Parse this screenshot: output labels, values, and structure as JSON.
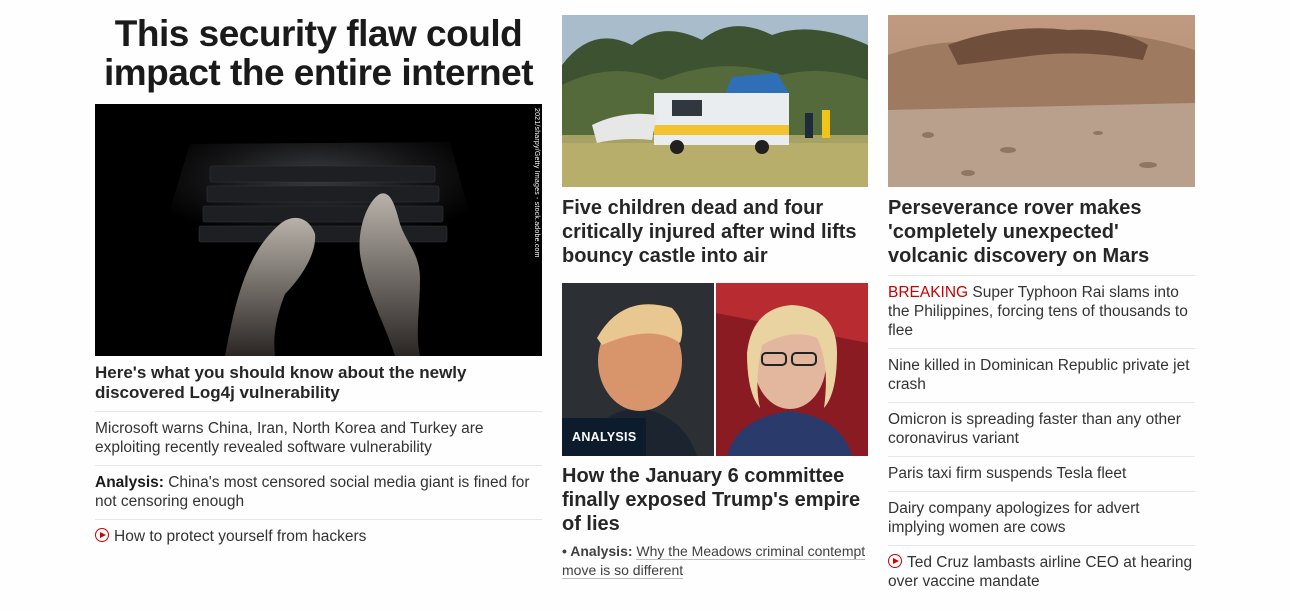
{
  "left": {
    "hero_title": "This security flaw could impact the entire internet",
    "image_credit": "2021/sharpy/Getty Images - stock.adobe.com",
    "headline": "Here's what you should know about the newly discovered Log4j vulnerability",
    "items": [
      {
        "text": "Microsoft warns China, Iran, North Korea and Turkey are exploiting recently revealed software vulnerability"
      },
      {
        "prefix": "Analysis:",
        "text": "China's most censored social media giant is fined for not censoring enough"
      },
      {
        "text": "How to protect yourself from hackers",
        "icon": "play-icon"
      }
    ]
  },
  "middle": {
    "top_headline": "Five children dead and four critically injured after wind lifts bouncy castle into air",
    "badge": "ANALYSIS",
    "second_headline": "How the January 6 committee finally exposed Trump's empire of lies",
    "sub_prefix": "• Analysis:",
    "sub_text": "Why the Meadows criminal contempt move is so different"
  },
  "right": {
    "headline": "Perseverance rover makes 'completely unexpected' volcanic discovery on Mars",
    "items": [
      {
        "label": "BREAKING",
        "text": "Super Typhoon Rai slams into the Philippines, forcing tens of thousands to flee"
      },
      {
        "text": "Nine killed in Dominican Republic private jet crash"
      },
      {
        "text": "Omicron is spreading faster than any other coronavirus variant"
      },
      {
        "text": "Paris taxi firm suspends Tesla fleet"
      },
      {
        "text": "Dairy company apologizes for advert implying women are cows"
      },
      {
        "text": "Ted Cruz lambasts airline CEO at hearing over vaccine mandate",
        "icon": "play-icon"
      }
    ]
  },
  "colors": {
    "accent_red": "#cc0000",
    "badge_bg": "#0c1c2c"
  }
}
